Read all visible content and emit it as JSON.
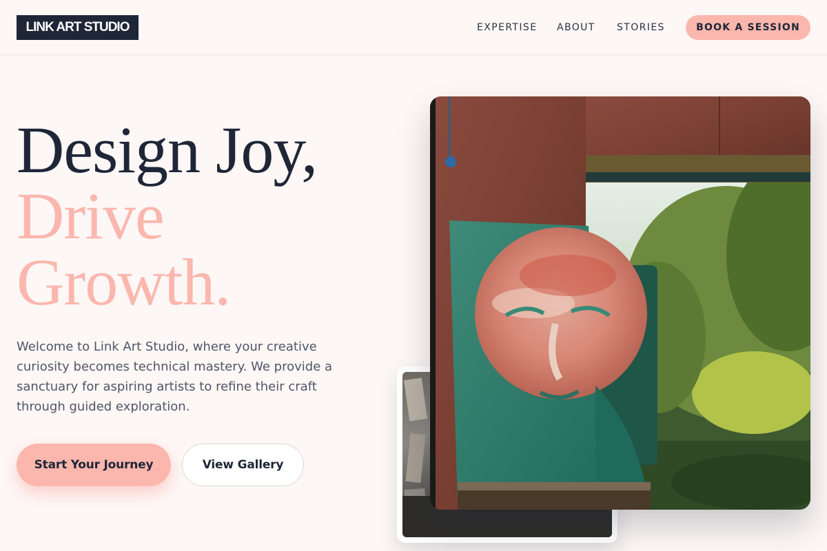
{
  "brand": {
    "logo_text": "LINK ART STUDIO"
  },
  "nav": {
    "items": [
      {
        "label": "EXPERTISE"
      },
      {
        "label": "ABOUT"
      },
      {
        "label": "STORIES"
      }
    ],
    "cta_label": "BOOK A SESSION"
  },
  "hero": {
    "title_line1": "Design Joy,",
    "title_line2": "Drive",
    "title_line3": "Growth.",
    "description": "Welcome to Link Art Studio, where your creative curiosity becomes technical mastery. We provide a sanctuary for aspiring artists to refine their craft through guided exploration.",
    "primary_button": "Start Your Journey",
    "secondary_button": "View Gallery"
  },
  "colors": {
    "navy": "#1e2637",
    "accent_pink": "#fbb7ad",
    "background": "#fdf7f6",
    "body_text": "#4f5666"
  },
  "images": {
    "main": "painted-face-artwork-photo",
    "secondary": "studio-canvases-photo"
  }
}
